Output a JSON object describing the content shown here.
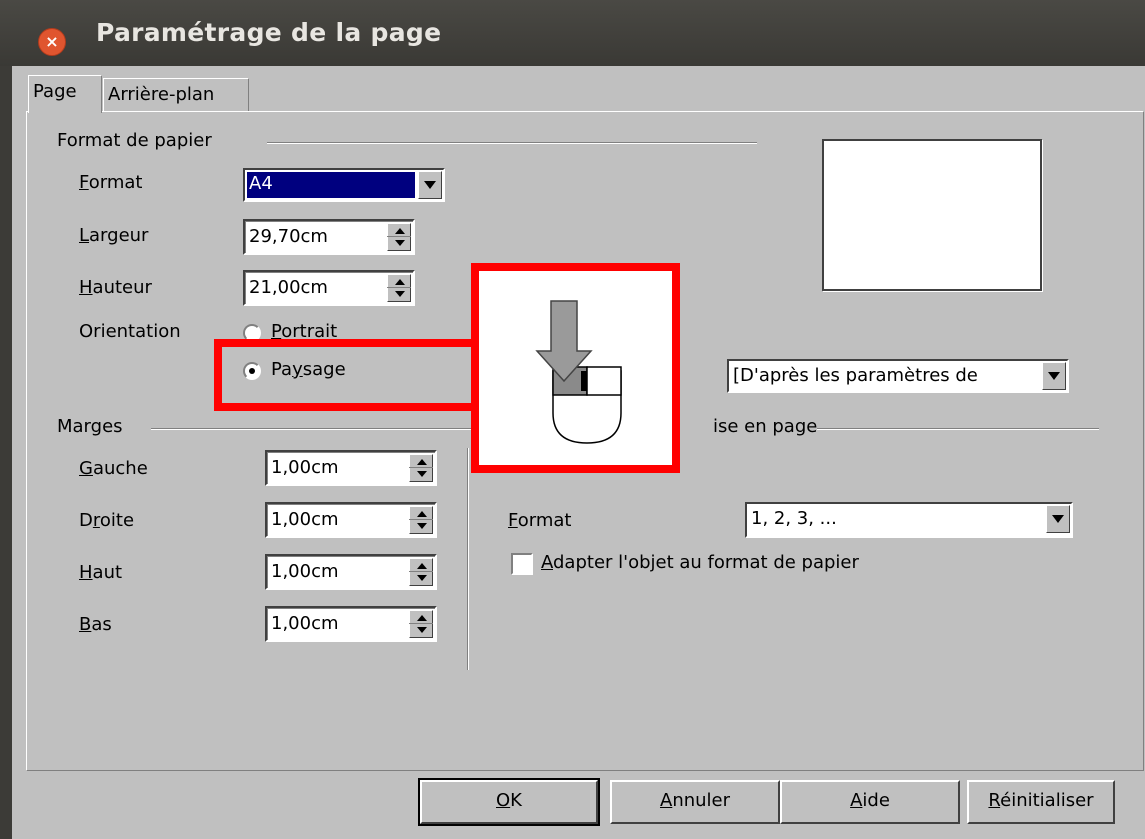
{
  "window": {
    "title": "Paramétrage de la page",
    "close_glyph": "×"
  },
  "tabs": [
    {
      "label": "Page"
    },
    {
      "label": "Arrière-plan"
    }
  ],
  "paper": {
    "heading": "Format de papier",
    "format_label_a": "F",
    "format_label_b": "ormat",
    "format_value": "A4",
    "width_label_a": "L",
    "width_label_b": "argeur",
    "width_value": "29,70cm",
    "height_label_a": "H",
    "height_label_b": "auteur",
    "height_value": "21,00cm",
    "orientation_label": "Orientation",
    "portrait_label_a": "P",
    "portrait_label_b": "ortrait",
    "landscape_label_a": "Pa",
    "landscape_label_b": "y",
    "landscape_label_c": "sage",
    "tray_value": "[D'après les paramètres de"
  },
  "margins": {
    "heading": "Marges",
    "left_label_a": "G",
    "left_label_b": "auche",
    "left_value": "1,00cm",
    "right_label_a": "D",
    "right_label_b": "r",
    "right_label_c": "oite",
    "right_value": "1,00cm",
    "top_label_a": "H",
    "top_label_b": "aut",
    "top_value": "1,00cm",
    "bottom_label_a": "B",
    "bottom_label_b": "as",
    "bottom_value": "1,00cm"
  },
  "layout": {
    "heading_visible": "ise en page",
    "format_label_a": "F",
    "format_label_b": "ormat",
    "format_value": "1, 2, 3, ...",
    "fit_label_a": "A",
    "fit_label_b": "dapter l'objet au format de papier"
  },
  "buttons": {
    "ok_a": "O",
    "ok_b": "K",
    "cancel_a": "A",
    "cancel_b": "nnuler",
    "help_a": "A",
    "help_b": "ide",
    "reset_a": "R",
    "reset_b": "éinitialiser"
  },
  "colors": {
    "highlight": "#ff0000",
    "selection": "#00007f"
  }
}
